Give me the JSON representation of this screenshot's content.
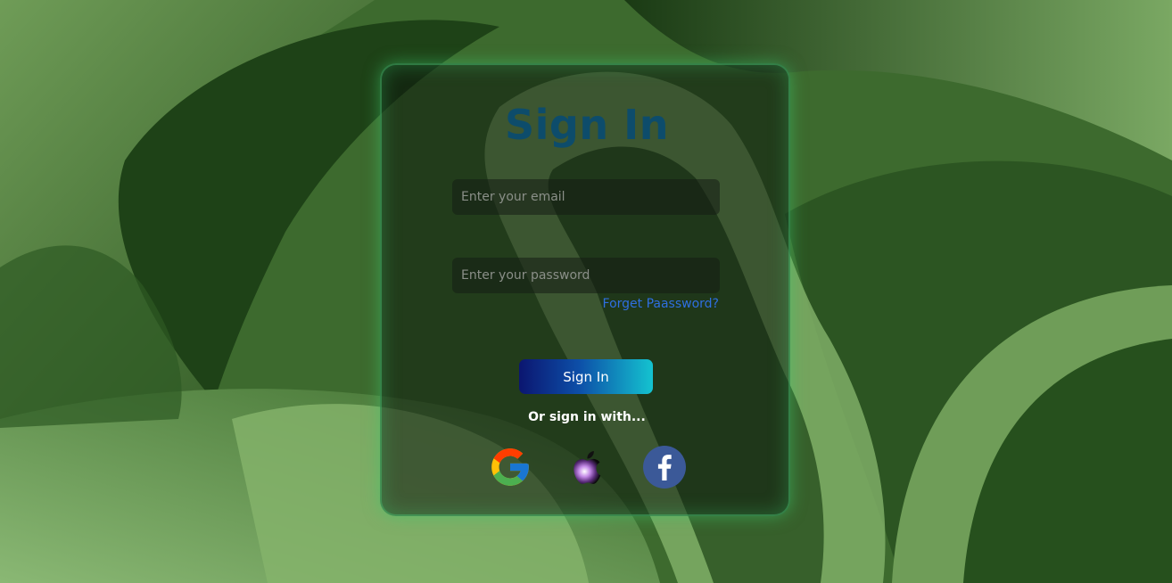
{
  "form": {
    "title": "Sign In",
    "email_placeholder": "Enter your email",
    "password_placeholder": "Enter your password",
    "forgot_label": "Forget Paassword?",
    "signin_label": "Sign In",
    "or_label": "Or sign in with..."
  },
  "social": [
    {
      "name": "google",
      "icon": "google-icon"
    },
    {
      "name": "apple",
      "icon": "apple-icon"
    },
    {
      "name": "facebook",
      "icon": "facebook-icon"
    }
  ],
  "colors": {
    "title": "#0d4c6b",
    "link": "#2f6fe0",
    "button_start": "#0b1670",
    "button_end": "#14c3d0",
    "card_glow": "#3cc86e"
  }
}
